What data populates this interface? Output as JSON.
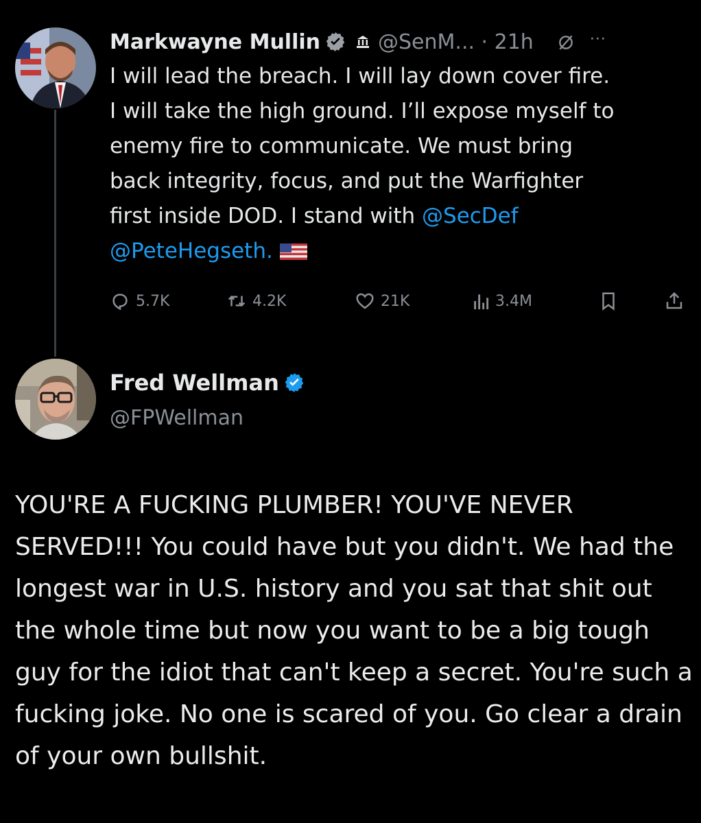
{
  "tweet": {
    "author_name": "Markwayne Mullin",
    "handle_time": "@SenM... · 21h",
    "more_label": "···",
    "body_lines": [
      "I will lead the breach. I will lay down cover fire.",
      "I will take the high ground. I’ll expose myself to",
      "enemy fire to communicate. We must bring",
      "back integrity, focus, and put the Warfighter"
    ],
    "body_last_prefix": "first inside DOD. I stand with ",
    "mention_1": "@SecDef",
    "mention_2": "@PeteHegseth.",
    "icons": {
      "verified": "verified-badge-icon",
      "government": "government-building-icon",
      "grok": "grok-icon",
      "flag": "us-flag-icon"
    },
    "stats": {
      "replies": "5.7K",
      "retweets": "4.2K",
      "likes": "21K",
      "views": "3.4M"
    }
  },
  "reply": {
    "author_name": "Fred Wellman",
    "handle": "@FPWellman",
    "text": "YOU'RE A FUCKING PLUMBER! YOU'VE NEVER SERVED!!! You could have but you didn't.  We had the longest war in U.S. history and you sat that shit out the whole time but now you want to be a big tough guy for the idiot that can't keep a secret. You're such a fucking joke. No one is scared of you. Go clear a drain of your own bullshit."
  },
  "colors": {
    "background": "#000000",
    "text": "#e7e9ea",
    "muted": "#8b9096",
    "link": "#1d9bf0",
    "verified": "#1d9bf0"
  }
}
